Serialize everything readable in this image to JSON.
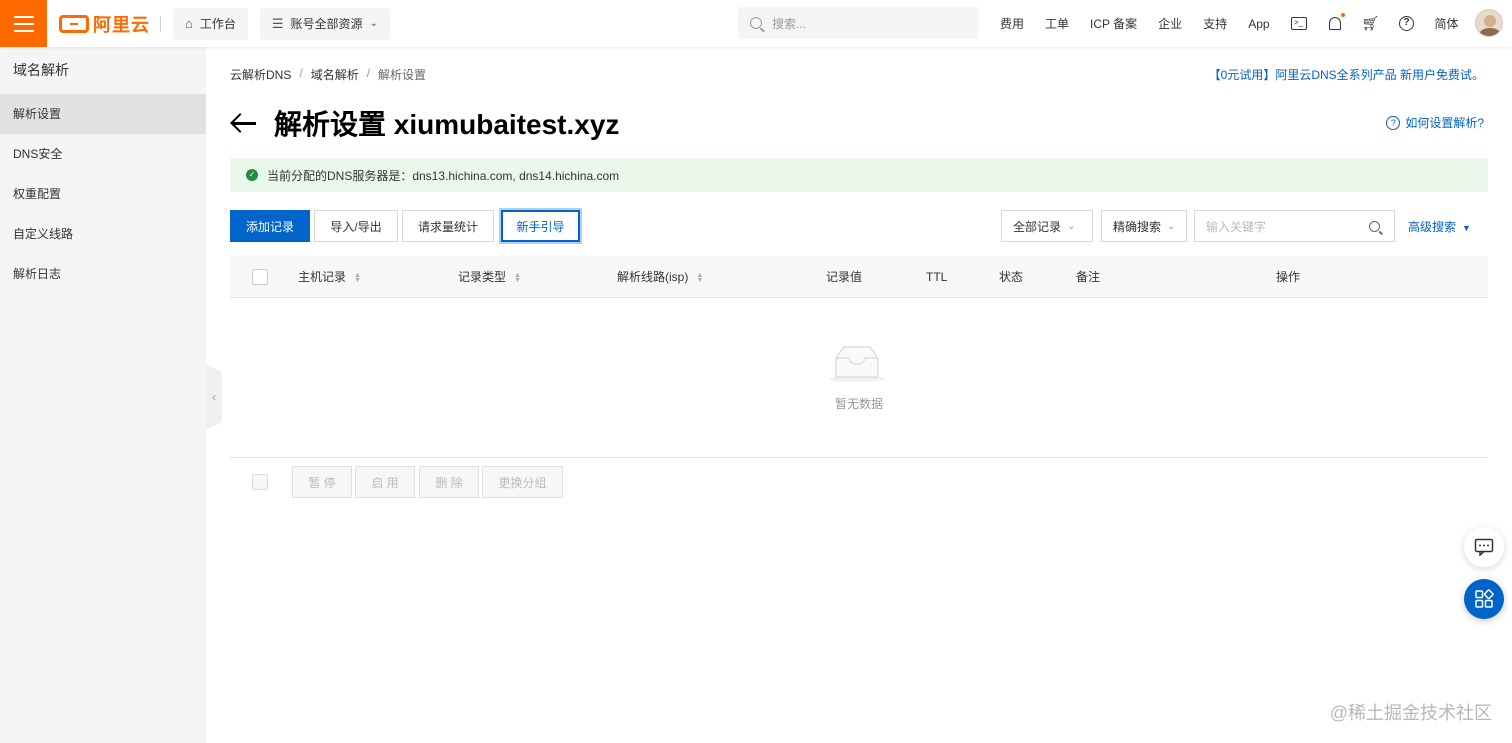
{
  "topbar": {
    "logo_text": "阿里云",
    "workbench_label": "工作台",
    "resources_label": "账号全部资源",
    "search_placeholder": "搜索...",
    "nav": [
      "费用",
      "工单",
      "ICP 备案",
      "企业",
      "支持",
      "App"
    ],
    "lang_label": "简体",
    "icons": [
      "menu-icon",
      "home-icon",
      "list-icon",
      "search-icon",
      "terminal-icon",
      "bell-icon",
      "cart-icon",
      "help-icon"
    ],
    "brand_color": "#ff6a00"
  },
  "sidebar": {
    "title": "域名解析",
    "items": [
      {
        "label": "解析设置",
        "active": true
      },
      {
        "label": "DNS安全"
      },
      {
        "label": "权重配置"
      },
      {
        "label": "自定义线路"
      },
      {
        "label": "解析日志"
      }
    ]
  },
  "breadcrumb": {
    "items": [
      "云解析DNS",
      "域名解析",
      "解析设置"
    ],
    "separator": "/"
  },
  "promo": "【0元试用】阿里云DNS全系列产品 新用户免费试。",
  "page": {
    "title": "解析设置 xiumubaitest.xyz",
    "help_link": "如何设置解析?"
  },
  "notice": {
    "text": "当前分配的DNS服务器是：dns13.hichina.com, dns14.hichina.com",
    "color": "#eaf8ec"
  },
  "toolbar": {
    "add_label": "添加记录",
    "import_export_label": "导入/导出",
    "stats_label": "请求量统计",
    "guide_label": "新手引导",
    "filter_label": "全部记录",
    "match_label": "精确搜索",
    "keyword_placeholder": "输入关键字",
    "advanced_label": "高级搜索",
    "accent_color": "#0064c8"
  },
  "table": {
    "columns": [
      "主机记录",
      "记录类型",
      "解析线路(isp)",
      "记录值",
      "TTL",
      "状态",
      "备注",
      "操作"
    ],
    "empty_text": "暂无数据"
  },
  "bulk_actions": {
    "pause_label": "暂 停",
    "enable_label": "启 用",
    "delete_label": "删 除",
    "change_group_label": "更换分组"
  },
  "watermark": "@稀土掘金技术社区"
}
